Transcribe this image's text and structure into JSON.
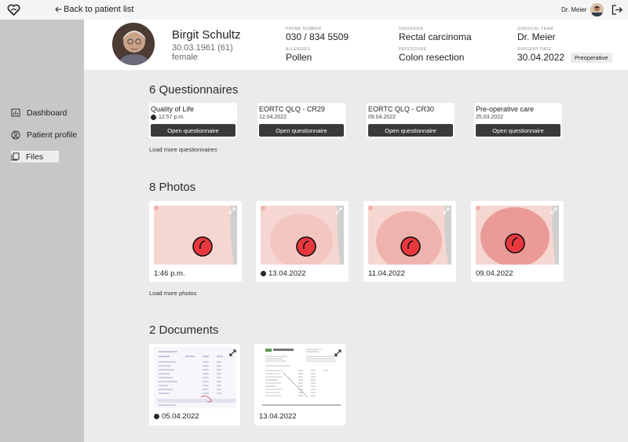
{
  "topbar": {
    "back_label": "Back to patient list",
    "user_name": "Dr. Meier"
  },
  "sidebar": {
    "items": [
      {
        "label": "Dashboard",
        "icon": "chart-icon"
      },
      {
        "label": "Patient profile",
        "icon": "person-icon"
      },
      {
        "label": "Files",
        "icon": "files-icon",
        "active": true
      }
    ]
  },
  "patient": {
    "name": "Birgit Schultz",
    "birth": "30.03.1961 (61)",
    "sex": "female",
    "phone_label": "PHONE NUMBER",
    "phone": "030 / 834 5509",
    "allergies_label": "ALLERGIES",
    "allergies": "Pollen",
    "diagnosis_label": "DIAGNOSIS",
    "diagnosis": "Rectal carcinoma",
    "procedure_label": "PROCEDURE",
    "procedure": "Colon resection",
    "team_label": "SURGICAL TEAM",
    "team": "Dr. Meier",
    "surgery_date_label": "SURGERY DATE",
    "surgery_date": "30.04.2022",
    "status": "Preoperative"
  },
  "questionnaires": {
    "title": "6 Questionnaires",
    "load_more": "Load more questionnaires",
    "items": [
      {
        "title": "Quality of Life",
        "date": "12:57 p.m.",
        "new": true,
        "button": "Open questionnaire"
      },
      {
        "title": "EORTC QLQ - CR29",
        "date": "12.04.2022",
        "new": false,
        "button": "Open questionnaire"
      },
      {
        "title": "EORTC QLQ - CR30",
        "date": "09.04.2022",
        "new": false,
        "button": "Open questionnaire"
      },
      {
        "title": "Pre-operative care",
        "date": "25.03.2022",
        "new": false,
        "button": "Open questionnaire"
      }
    ]
  },
  "photos": {
    "title": "8 Photos",
    "load_more": "Load more photos",
    "items": [
      {
        "date": "1:46 p.m.",
        "new": false
      },
      {
        "date": "13.04.2022",
        "new": true
      },
      {
        "date": "11.04.2022",
        "new": false
      },
      {
        "date": "09.04.2022",
        "new": false
      }
    ]
  },
  "documents": {
    "title": "2 Documents",
    "items": [
      {
        "date": "05.04.2022",
        "new": true
      },
      {
        "date": "13.04.2022",
        "new": false
      }
    ]
  },
  "colors": {
    "sidebar": "#c7c7c7",
    "background": "#ebebeb",
    "button": "#3a3a3a",
    "stoma": "#e8383d"
  }
}
